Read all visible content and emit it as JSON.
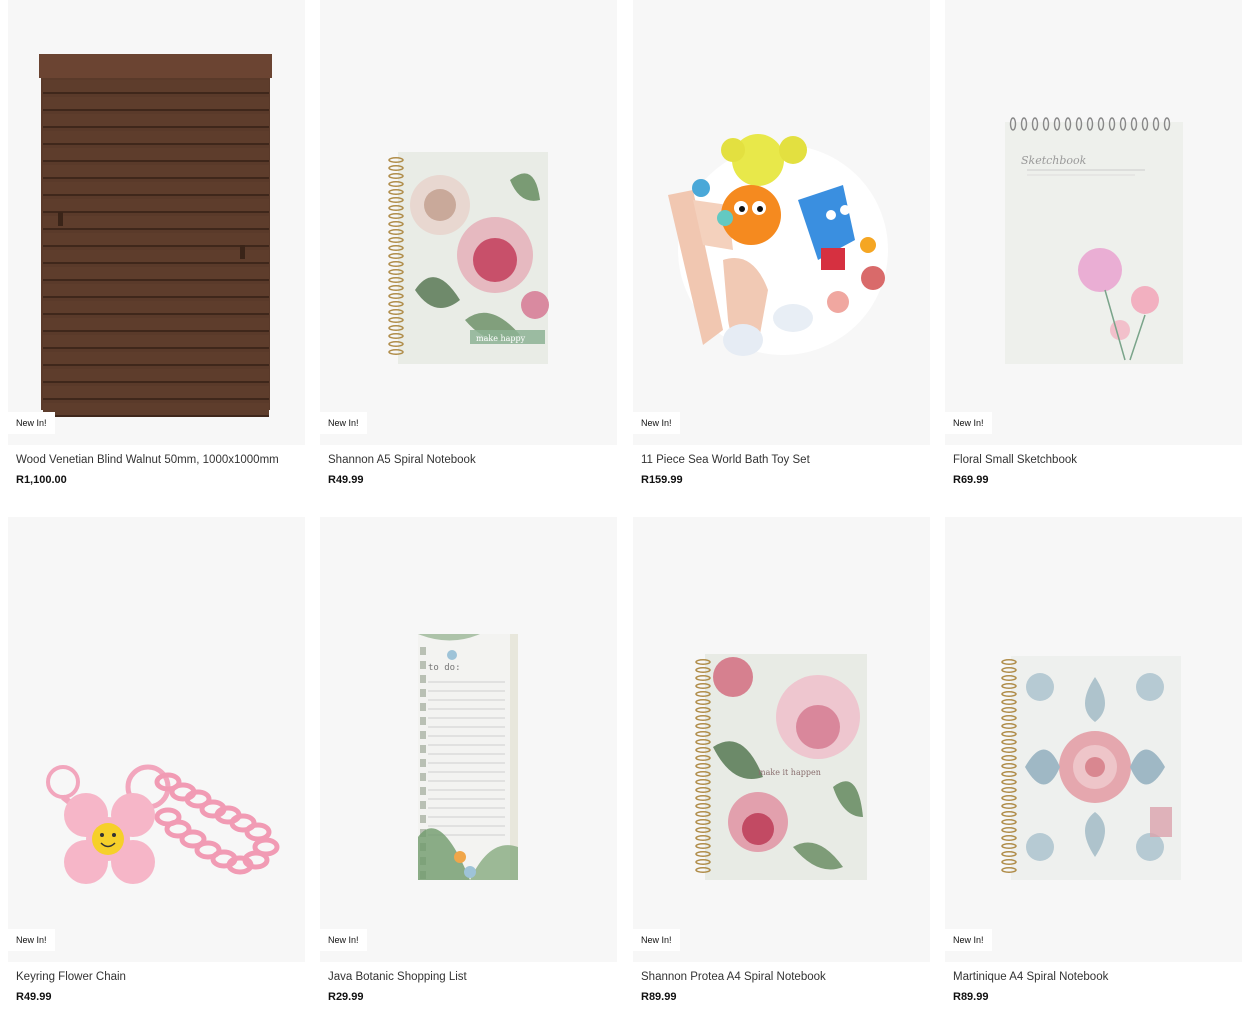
{
  "products": [
    {
      "badge": "New In!",
      "title": "Wood Venetian Blind Walnut 50mm, 1000x1000mm",
      "price": "R1,100.00",
      "image_icon": "venetian-blind-image"
    },
    {
      "badge": "New In!",
      "title": "Shannon A5 Spiral Notebook",
      "price": "R49.99",
      "image_icon": "floral-notebook-image"
    },
    {
      "badge": "New In!",
      "title": "11 Piece Sea World Bath Toy Set",
      "price": "R159.99",
      "image_icon": "bath-toys-image"
    },
    {
      "badge": "New In!",
      "title": "Floral Small Sketchbook",
      "price": "R69.99",
      "image_icon": "sketchbook-image"
    },
    {
      "badge": "New In!",
      "title": "Keyring Flower Chain",
      "price": "R49.99",
      "image_icon": "keyring-image"
    },
    {
      "badge": "New In!",
      "title": "Java Botanic Shopping List",
      "price": "R29.99",
      "image_icon": "shopping-list-image"
    },
    {
      "badge": "New In!",
      "title": "Shannon Protea A4 Spiral Notebook",
      "price": "R89.99",
      "image_icon": "protea-notebook-image"
    },
    {
      "badge": "New In!",
      "title": "Martinique A4 Spiral Notebook",
      "price": "R89.99",
      "image_icon": "martinique-notebook-image"
    }
  ],
  "image_text": {
    "notebook_label": "make happy",
    "shopping_list_label": "to do:",
    "sketchbook_label": "Sketchbook",
    "protea_label": "make it happen"
  },
  "colors": {
    "card_background": "#f7f7f7",
    "badge_background": "#ffffff",
    "price_text": "#111111"
  }
}
